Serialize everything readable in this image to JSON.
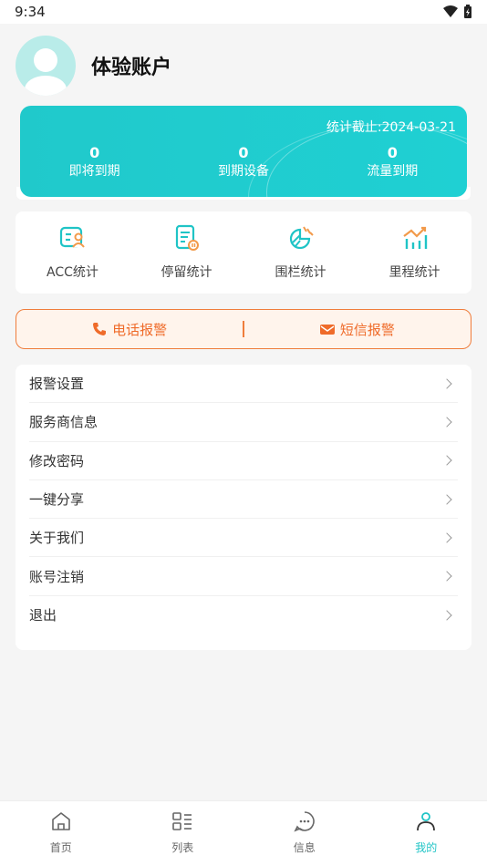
{
  "status_bar": {
    "time": "9:34"
  },
  "profile": {
    "username": "体验账户"
  },
  "stats": {
    "date_label": "统计截止:2024-03-21",
    "items": [
      {
        "value": "0",
        "label": "即将到期"
      },
      {
        "value": "0",
        "label": "到期设备"
      },
      {
        "value": "0",
        "label": "流量到期"
      }
    ]
  },
  "shortcuts": [
    {
      "label": "ACC统计",
      "icon": "acc-stats-icon"
    },
    {
      "label": "停留统计",
      "icon": "stay-stats-icon"
    },
    {
      "label": "围栏统计",
      "icon": "fence-stats-icon"
    },
    {
      "label": "里程统计",
      "icon": "mileage-stats-icon"
    }
  ],
  "alarms": {
    "phone": "电话报警",
    "sms": "短信报警"
  },
  "menu": [
    "报警设置",
    "服务商信息",
    "修改密码",
    "一键分享",
    "关于我们",
    "账号注销",
    "退出"
  ],
  "tabs": [
    {
      "label": "首页",
      "icon": "home-icon"
    },
    {
      "label": "列表",
      "icon": "list-icon"
    },
    {
      "label": "信息",
      "icon": "message-icon"
    },
    {
      "label": "我的",
      "icon": "profile-icon",
      "active": true
    }
  ],
  "colors": {
    "accent": "#1fc4c6",
    "alarm": "#ef6b2a"
  }
}
